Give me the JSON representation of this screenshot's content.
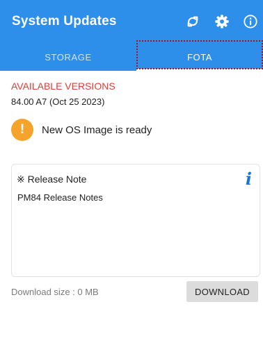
{
  "appbar": {
    "title": "System Updates",
    "icons": [
      "refresh-icon",
      "gear-icon",
      "info-icon"
    ],
    "color": "#2E8FEA"
  },
  "tabs": [
    {
      "label": "STORAGE",
      "selected": false
    },
    {
      "label": "FOTA",
      "selected": true
    }
  ],
  "content": {
    "available_label": "AVAILABLE VERSIONS",
    "available_color": "#e53935",
    "version": "84.00 A7 (Oct 25 2023)",
    "status_icon_glyph": "!",
    "status_text": "New OS Image is ready"
  },
  "release_note": {
    "title": "※ Release Note",
    "info_glyph": "i",
    "body": "PM84 Release Notes"
  },
  "footer": {
    "download_size": "Download size : 0 MB",
    "download_button": "DOWNLOAD"
  }
}
